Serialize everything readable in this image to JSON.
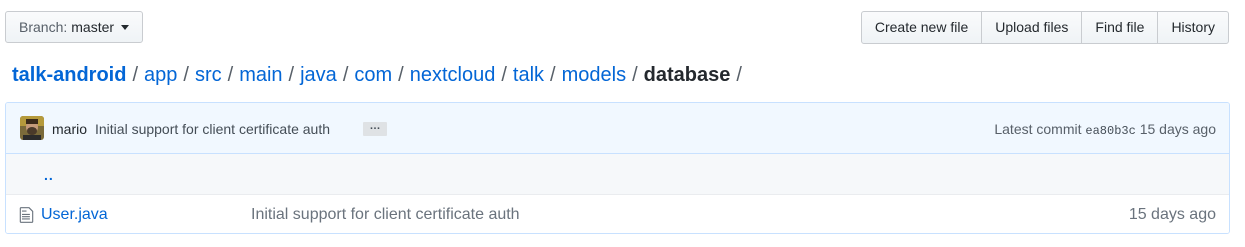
{
  "toolbar": {
    "branch_prefix": "Branch:",
    "branch_name": "master",
    "buttons": [
      "Create new file",
      "Upload files",
      "Find file",
      "History"
    ]
  },
  "breadcrumb": {
    "repo": "talk-android",
    "path": [
      "app",
      "src",
      "main",
      "java",
      "com",
      "nextcloud",
      "talk",
      "models"
    ],
    "current": "database",
    "separator": "/"
  },
  "commit": {
    "author": "mario",
    "message": "Initial support for client certificate auth",
    "ellipsis": "…",
    "latest_label": "Latest commit",
    "sha": "ea80b3c",
    "age": "15 days ago"
  },
  "files": {
    "up_link": "..",
    "rows": [
      {
        "name": "User.java",
        "message": "Initial support for client certificate auth",
        "age": "15 days ago",
        "icon": "file-icon"
      }
    ]
  },
  "colors": {
    "link": "#0366d6",
    "commit_bar_bg": "#f1f8ff",
    "commit_bar_border": "#c8e1ff"
  }
}
